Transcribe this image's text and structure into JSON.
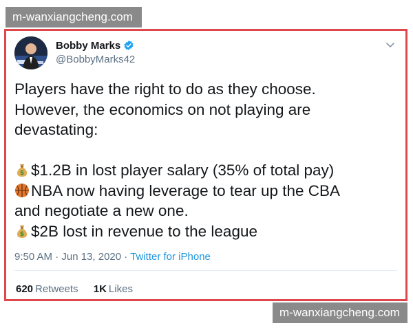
{
  "watermarks": {
    "top": "m-wanxiangcheng.com",
    "bottom": "m-wanxiangcheng.com"
  },
  "tweet": {
    "author": {
      "display_name": "Bobby Marks",
      "handle": "@BobbyMarks42",
      "verified": true,
      "avatar_icon": "avatar-photo"
    },
    "menu_icon": "chevron-down-icon",
    "text_lines": {
      "l1": "Players have the right to do as they choose.",
      "l2": "However, the economics on not playing are",
      "l3": "devastating:",
      "l4": "$1.2B in lost player salary (35% of total pay)",
      "l5": "NBA now having leverage to tear up the CBA",
      "l6": "and negotiate a new one.",
      "l7": "$2B lost in revenue to the league"
    },
    "emojis": {
      "money_bag": "money-bag-icon",
      "basketball": "basketball-icon"
    },
    "timestamp": "9:50 AM · Jun 13, 2020 · ",
    "source": "Twitter for iPhone",
    "retweets": {
      "count": "620",
      "label": "Retweets"
    },
    "likes": {
      "count": "1K",
      "label": "Likes"
    }
  },
  "colors": {
    "highlight_border": "#e0474c",
    "link": "#1b95e0",
    "verified": "#1da1f2",
    "muted_text": "#5b7083"
  }
}
